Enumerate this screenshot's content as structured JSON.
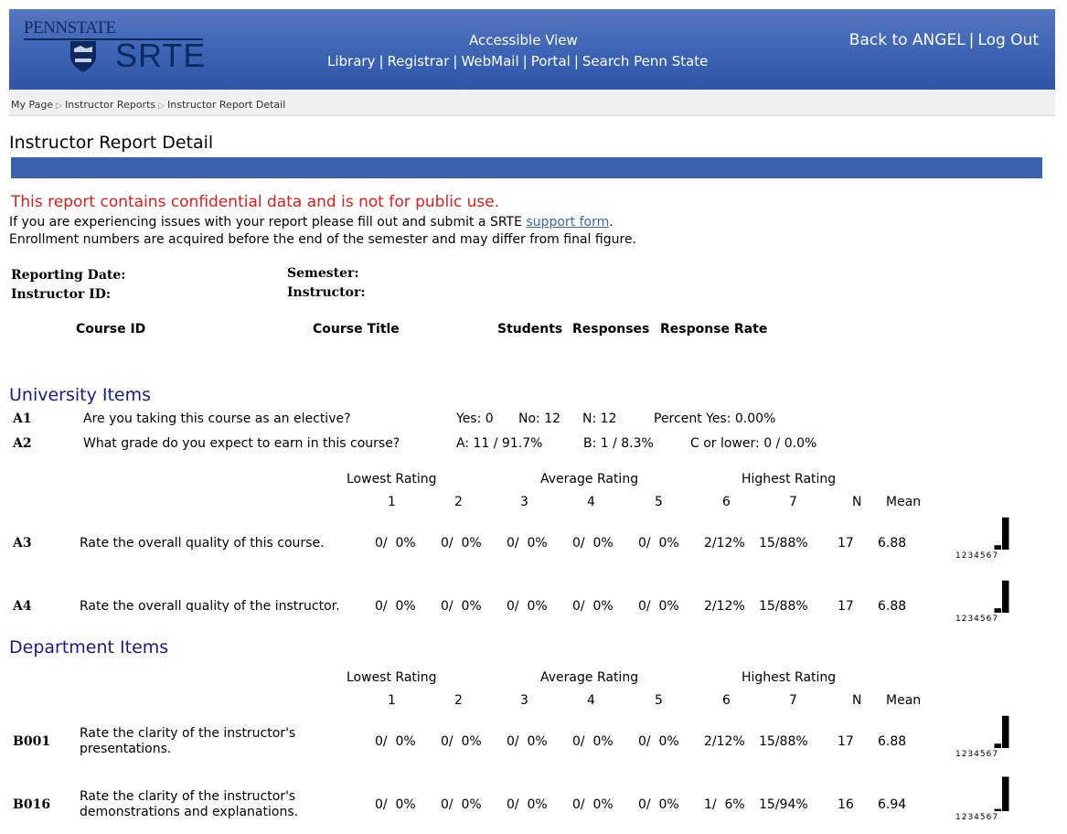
{
  "header": {
    "logo_top": "PENNSTATE",
    "logo_bottom": "SRTE",
    "accessible_view": "Accessible View",
    "links": [
      "Library",
      "Registrar",
      "WebMail",
      "Portal",
      "Search Penn State"
    ],
    "right_links": [
      "Back to ANGEL",
      "Log Out"
    ],
    "separator": "|"
  },
  "breadcrumb": [
    "My Page",
    "Instructor Reports",
    "Instructor Report Detail"
  ],
  "page_title": "Instructor Report Detail",
  "notices": {
    "confidential": "This report contains confidential data and is not for public use.",
    "support_pre": "If you are experiencing issues with your report please fill out and submit a SRTE ",
    "support_link": "support form",
    "support_post": ".",
    "enrollment": "Enrollment numbers are acquired before the end of the semester and may differ from final figure."
  },
  "report_info": {
    "reporting_date_label": "Reporting Date:",
    "instructor_id_label": "Instructor ID:",
    "semester_label": "Semester:",
    "instructor_label": "Instructor:"
  },
  "course_table_headers": [
    "Course ID",
    "Course Title",
    "Students",
    "Responses",
    "Response Rate"
  ],
  "university": {
    "title": "University Items",
    "a1": {
      "id": "A1",
      "q": "Are you taking this course as an elective?",
      "yes": "Yes: 0",
      "no": "No: 12",
      "n": "N: 12",
      "pct": "Percent Yes: 0.00%"
    },
    "a2": {
      "id": "A2",
      "q": "What grade do you expect to earn in this course?",
      "a": "A: 11 / 91.7%",
      "b": "B: 1 / 8.3%",
      "c": "C or lower: 0 / 0.0%"
    }
  },
  "rating_header": {
    "lowest": "Lowest Rating",
    "average": "Average Rating",
    "highest": "Highest Rating",
    "cols": [
      "1",
      "2",
      "3",
      "4",
      "5",
      "6",
      "7",
      "N",
      "Mean"
    ]
  },
  "mini_scale": "1234567",
  "rows_university": [
    {
      "id": "A3",
      "q1": "Rate the overall quality of this course.",
      "q2": "",
      "vals": [
        "0/  0%",
        "0/  0%",
        "0/  0%",
        "0/  0%",
        "0/  0%",
        "2/12%",
        "15/88%"
      ],
      "n": "17",
      "mean": "6.88",
      "dist": [
        0,
        0,
        0,
        0,
        0,
        12,
        88
      ]
    },
    {
      "id": "A4",
      "q1": "Rate the overall quality of the instructor.",
      "q2": "",
      "vals": [
        "0/  0%",
        "0/  0%",
        "0/  0%",
        "0/  0%",
        "0/  0%",
        "2/12%",
        "15/88%"
      ],
      "n": "17",
      "mean": "6.88",
      "dist": [
        0,
        0,
        0,
        0,
        0,
        12,
        88
      ]
    }
  ],
  "department": {
    "title": "Department Items"
  },
  "rows_department": [
    {
      "id": "B001",
      "q1": "Rate the clarity of the instructor's",
      "q2": "presentations.",
      "vals": [
        "0/  0%",
        "0/  0%",
        "0/  0%",
        "0/  0%",
        "0/  0%",
        "2/12%",
        "15/88%"
      ],
      "n": "17",
      "mean": "6.88",
      "dist": [
        0,
        0,
        0,
        0,
        0,
        12,
        88
      ]
    },
    {
      "id": "B016",
      "q1": "Rate the clarity of the instructor's",
      "q2": "demonstrations and explanations.",
      "vals": [
        "0/  0%",
        "0/  0%",
        "0/  0%",
        "0/  0%",
        "0/  0%",
        "1/  6%",
        "15/94%"
      ],
      "n": "16",
      "mean": "6.94",
      "dist": [
        0,
        0,
        0,
        0,
        0,
        6,
        94
      ]
    }
  ],
  "colors": {
    "header_blue": "#3c63b4",
    "bar_blue": "#3c62ad",
    "confidential_red": "#e01b1b",
    "section_navy": "#1a1a80",
    "link_blue": "#3766aa"
  }
}
